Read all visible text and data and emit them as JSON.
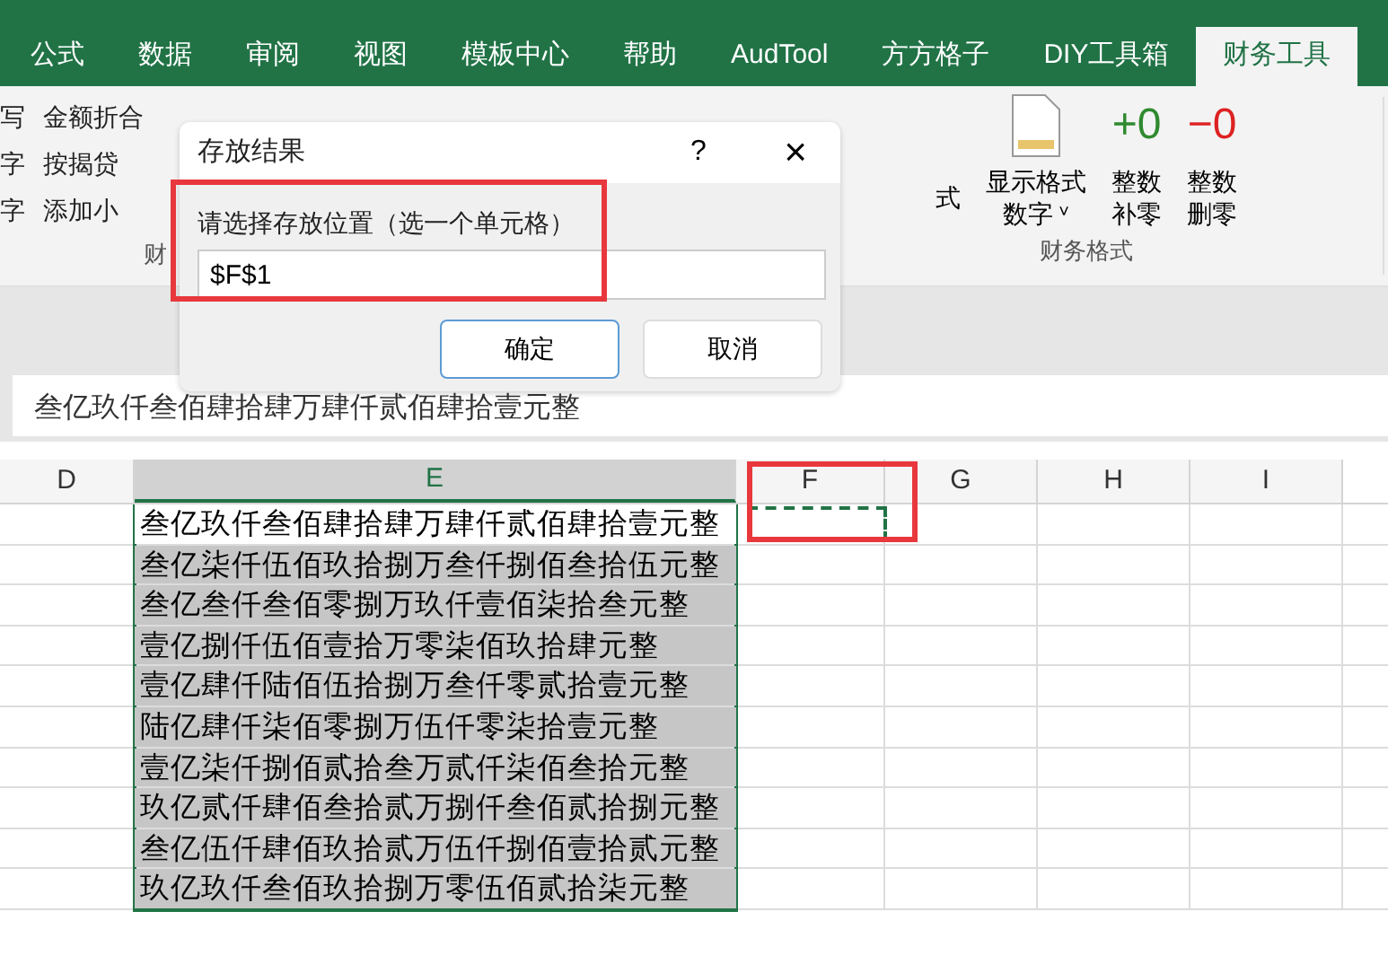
{
  "tabs": [
    {
      "label": "公式",
      "selected": false
    },
    {
      "label": "数据",
      "selected": false
    },
    {
      "label": "审阅",
      "selected": false
    },
    {
      "label": "视图",
      "selected": false
    },
    {
      "label": "模板中心",
      "selected": false
    },
    {
      "label": "帮助",
      "selected": false
    },
    {
      "label": "AudTool",
      "selected": false
    },
    {
      "label": "方方格子",
      "selected": false
    },
    {
      "label": "DIY工具箱",
      "selected": false
    },
    {
      "label": "财务工具",
      "selected": true
    }
  ],
  "ribbon": {
    "left_rows": [
      [
        "写",
        "金额折合"
      ],
      [
        "字",
        "按揭贷"
      ],
      [
        "字",
        "添加小"
      ]
    ],
    "left_group": "财",
    "cut_label": "式",
    "buttons": [
      {
        "kind": "doc",
        "line1": "显示格式",
        "line2": "数字",
        "caret": "˅"
      },
      {
        "kind": "plus",
        "glyph": "+0",
        "line1": "整数",
        "line2": "补零"
      },
      {
        "kind": "minus",
        "glyph": "−0",
        "line1": "整数",
        "line2": "删零"
      }
    ],
    "group": "财务格式"
  },
  "formula_bar": {
    "value": "叁亿玖仟叁佰肆拾肆万肆仟贰佰肆拾壹元整"
  },
  "columns": [
    {
      "label": "D",
      "selected": false
    },
    {
      "label": "E",
      "selected": true
    },
    {
      "label": "F",
      "selected": false
    },
    {
      "label": "G",
      "selected": false
    },
    {
      "label": "H",
      "selected": false
    },
    {
      "label": "I",
      "selected": false
    }
  ],
  "rows": [
    {
      "value": "叁亿玖仟叁佰肆拾肆万肆仟贰佰肆拾壹元整",
      "active": true
    },
    {
      "value": "叁亿柒仟伍佰玖拾捌万叁仟捌佰叁拾伍元整",
      "active": false
    },
    {
      "value": "叁亿叁仟叁佰零捌万玖仟壹佰柒拾叁元整",
      "active": false
    },
    {
      "value": "壹亿捌仟伍佰壹拾万零柒佰玖拾肆元整",
      "active": false
    },
    {
      "value": "壹亿肆仟陆佰伍拾捌万叁仟零贰拾壹元整",
      "active": false
    },
    {
      "value": "陆亿肆仟柒佰零捌万伍仟零柒拾壹元整",
      "active": false
    },
    {
      "value": "壹亿柒仟捌佰贰拾叁万贰仟柒佰叁拾元整",
      "active": false
    },
    {
      "value": "玖亿贰仟肆佰叁拾贰万捌仟叁佰贰拾捌元整",
      "active": false
    },
    {
      "value": "叁亿伍仟肆佰玖拾贰万伍仟捌佰壹拾贰元整",
      "active": false
    },
    {
      "value": "玖亿玖仟叁佰玖拾捌万零伍佰贰拾柒元整",
      "active": false
    }
  ],
  "dialog": {
    "title": "存放结果",
    "help": "?",
    "close": "×",
    "label": "请选择存放位置（选一个单元格）",
    "value": "$F$1",
    "ok": "确定",
    "cancel": "取消"
  }
}
